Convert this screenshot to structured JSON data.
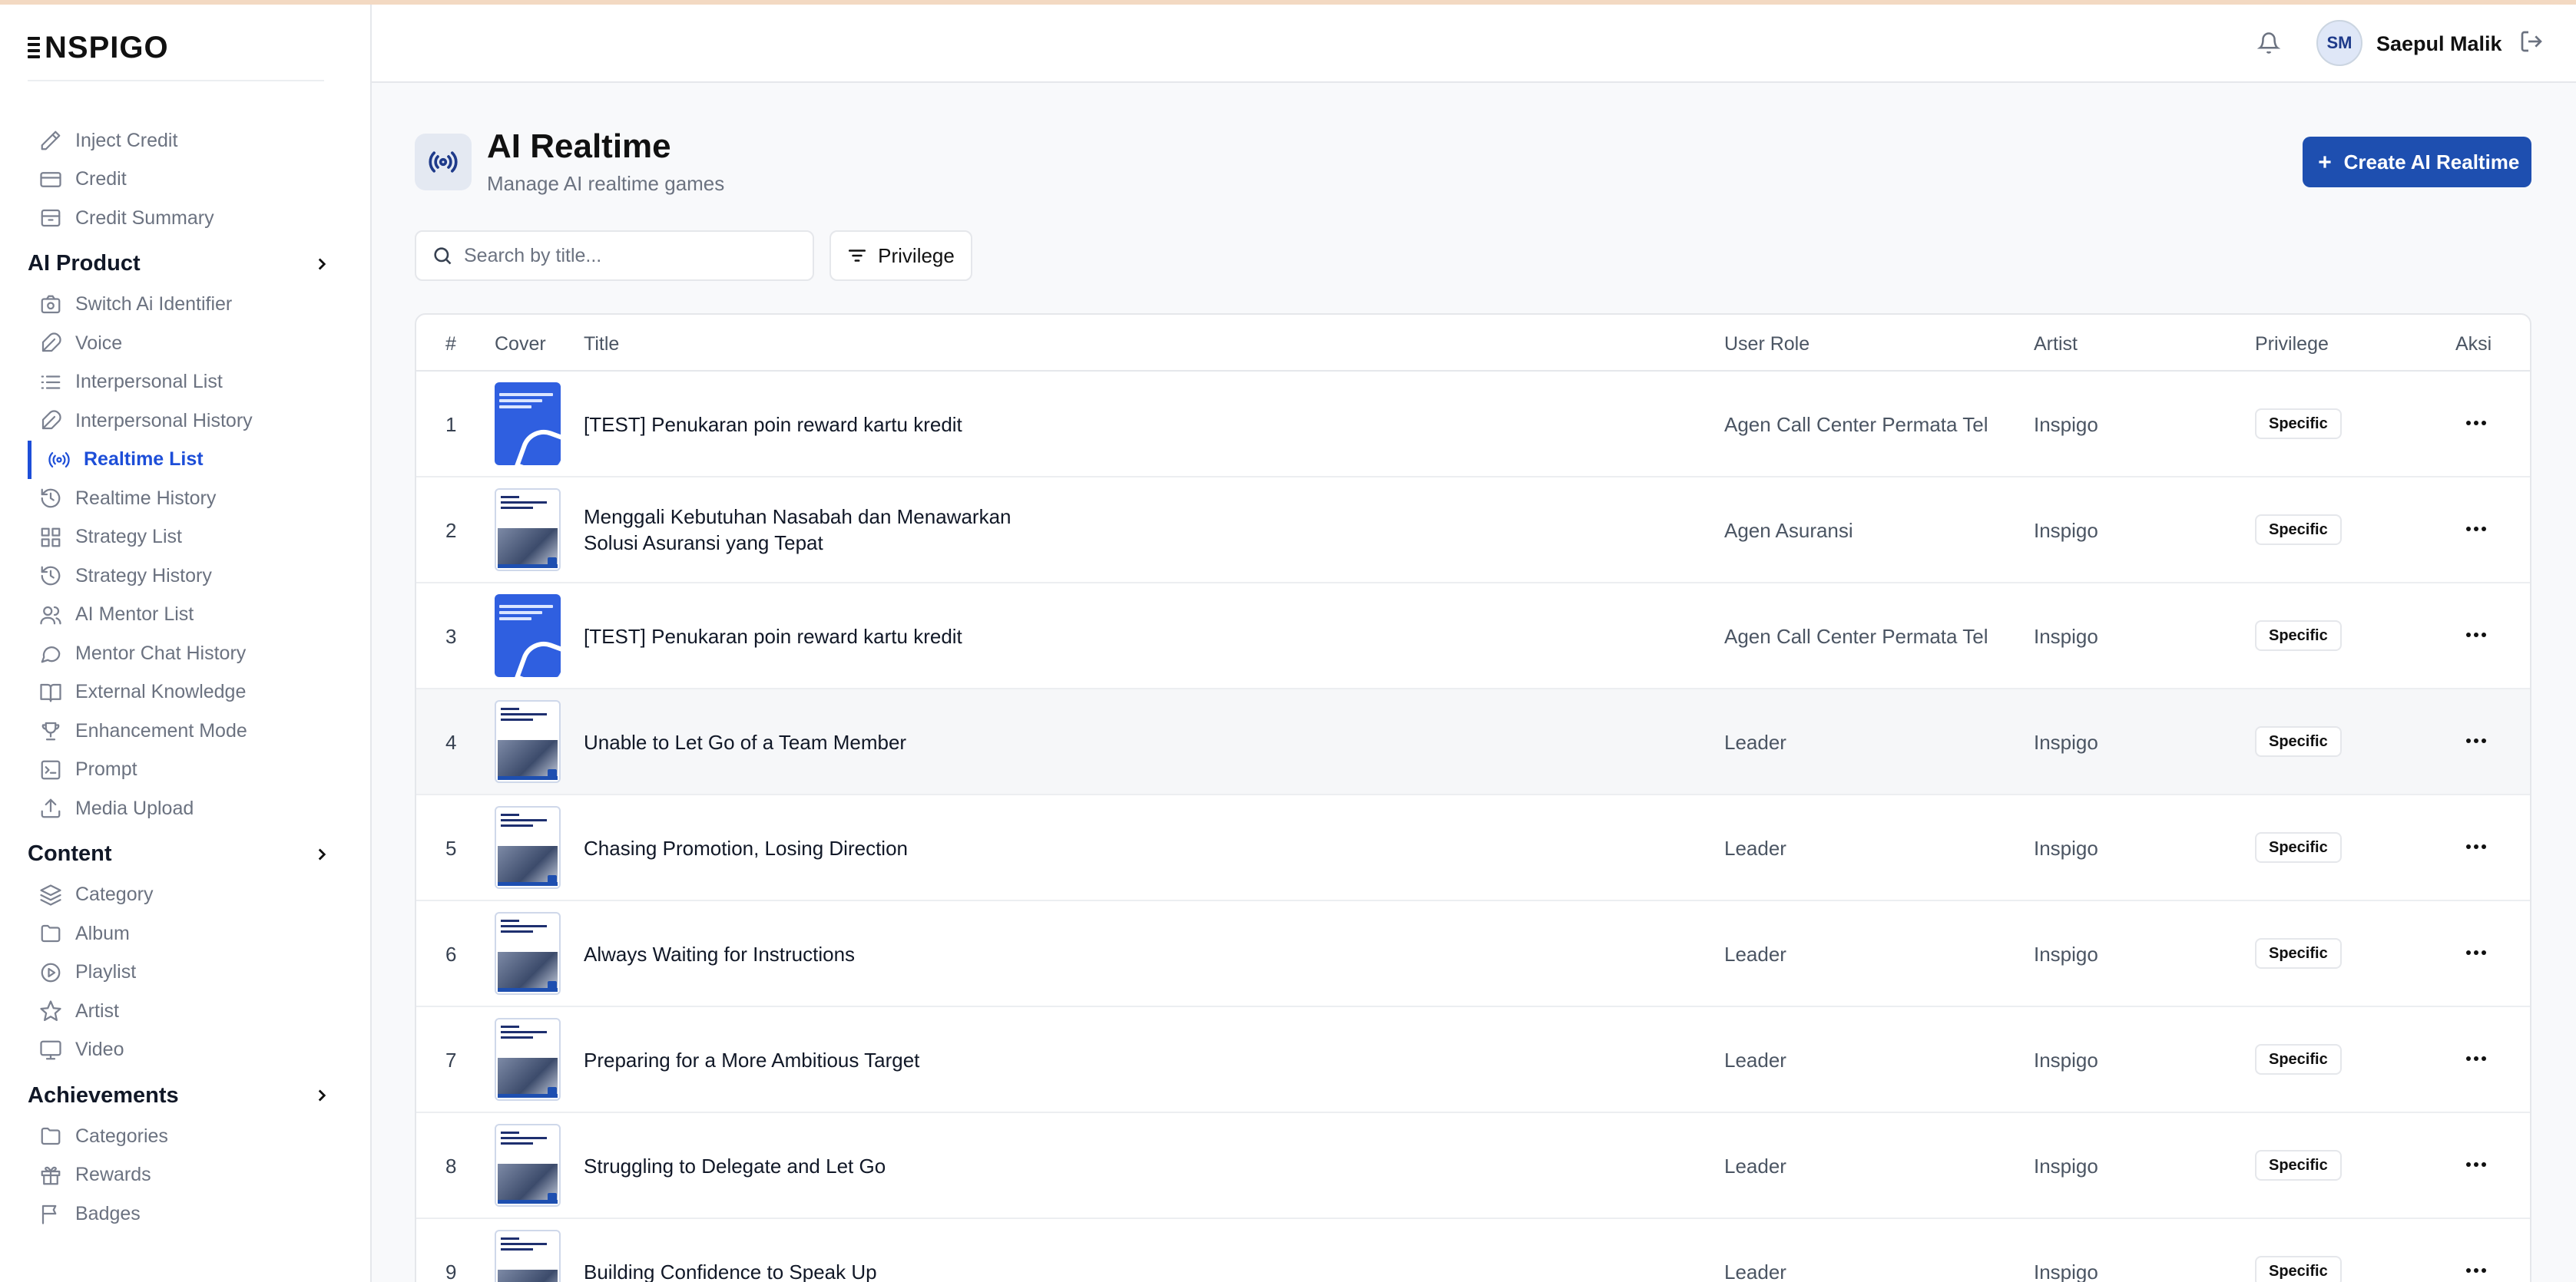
{
  "app": {
    "logo_text": "NSPIGO"
  },
  "sidebar": {
    "top_items": [
      {
        "label": "Inject Credit",
        "icon": "pen-icon"
      },
      {
        "label": "Credit",
        "icon": "card-icon"
      },
      {
        "label": "Credit Summary",
        "icon": "archive-icon"
      }
    ],
    "sections": [
      {
        "title": "AI Product",
        "items": [
          {
            "label": "Switch Ai Identifier",
            "icon": "switch-camera-icon"
          },
          {
            "label": "Voice",
            "icon": "feather-icon"
          },
          {
            "label": "Interpersonal List",
            "icon": "list-icon"
          },
          {
            "label": "Interpersonal History",
            "icon": "feather-icon"
          },
          {
            "label": "Realtime List",
            "icon": "radio-icon",
            "active": true
          },
          {
            "label": "Realtime History",
            "icon": "history-icon"
          },
          {
            "label": "Strategy List",
            "icon": "grid-icon"
          },
          {
            "label": "Strategy History",
            "icon": "history-icon"
          },
          {
            "label": "AI Mentor List",
            "icon": "users-icon"
          },
          {
            "label": "Mentor Chat History",
            "icon": "chat-icon"
          },
          {
            "label": "External Knowledge",
            "icon": "book-icon"
          },
          {
            "label": "Enhancement Mode",
            "icon": "trophy-icon"
          },
          {
            "label": "Prompt",
            "icon": "terminal-icon"
          },
          {
            "label": "Media Upload",
            "icon": "upload-icon"
          }
        ]
      },
      {
        "title": "Content",
        "items": [
          {
            "label": "Category",
            "icon": "layers-icon"
          },
          {
            "label": "Album",
            "icon": "folder-icon"
          },
          {
            "label": "Playlist",
            "icon": "play-circle-icon"
          },
          {
            "label": "Artist",
            "icon": "star-icon"
          },
          {
            "label": "Video",
            "icon": "monitor-icon"
          }
        ]
      },
      {
        "title": "Achievements",
        "items": [
          {
            "label": "Categories",
            "icon": "folder-icon"
          },
          {
            "label": "Rewards",
            "icon": "gift-icon"
          },
          {
            "label": "Badges",
            "icon": "flag-icon"
          }
        ]
      }
    ]
  },
  "header": {
    "avatar_initials": "SM",
    "user_name": "Saepul Malik"
  },
  "page": {
    "title": "AI Realtime",
    "subtitle": "Manage AI realtime games",
    "create_label": "Create AI Realtime",
    "search_placeholder": "Search by title...",
    "filter_label": "Privilege"
  },
  "table": {
    "columns": [
      "#",
      "Cover",
      "Title",
      "User Role",
      "Artist",
      "Privilege",
      "Aksi"
    ],
    "rows": [
      {
        "num": "1",
        "cover": "blue",
        "title": "[TEST] Penukaran poin reward kartu kredit",
        "role": "Agen Call Center Permata Tel",
        "artist": "Inspigo",
        "privilege": "Specific"
      },
      {
        "num": "2",
        "cover": "white",
        "title": "Menggali Kebutuhan Nasabah dan Menawarkan Solusi Asuransi yang Tepat",
        "role": "Agen Asuransi",
        "artist": "Inspigo",
        "privilege": "Specific"
      },
      {
        "num": "3",
        "cover": "blue",
        "title": "[TEST] Penukaran poin reward kartu kredit",
        "role": "Agen Call Center Permata Tel",
        "artist": "Inspigo",
        "privilege": "Specific"
      },
      {
        "num": "4",
        "cover": "white",
        "title": "Unable to Let Go of a Team Member",
        "role": "Leader",
        "artist": "Inspigo",
        "privilege": "Specific"
      },
      {
        "num": "5",
        "cover": "white",
        "title": "Chasing Promotion, Losing Direction",
        "role": "Leader",
        "artist": "Inspigo",
        "privilege": "Specific"
      },
      {
        "num": "6",
        "cover": "white",
        "title": "Always Waiting for Instructions",
        "role": "Leader",
        "artist": "Inspigo",
        "privilege": "Specific"
      },
      {
        "num": "7",
        "cover": "white",
        "title": "Preparing for a More Ambitious Target",
        "role": "Leader",
        "artist": "Inspigo",
        "privilege": "Specific"
      },
      {
        "num": "8",
        "cover": "white",
        "title": "Struggling to Delegate and Let Go",
        "role": "Leader",
        "artist": "Inspigo",
        "privilege": "Specific"
      },
      {
        "num": "9",
        "cover": "white",
        "title": "Building Confidence to Speak Up",
        "role": "Leader",
        "artist": "Inspigo",
        "privilege": "Specific"
      }
    ]
  }
}
